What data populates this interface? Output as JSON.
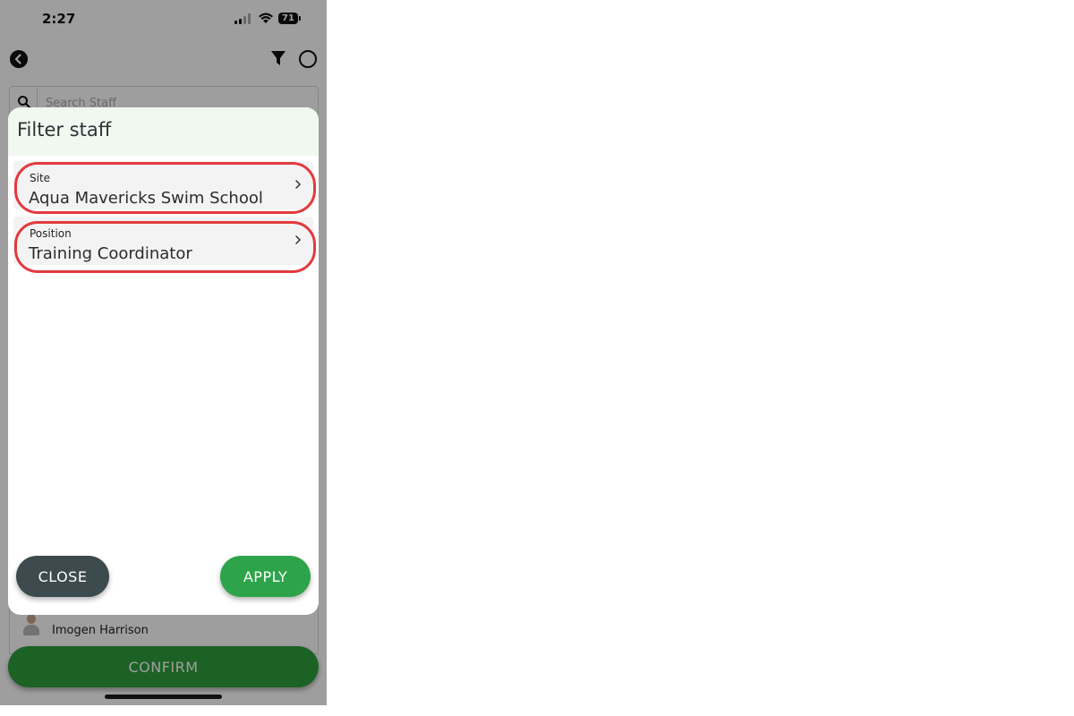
{
  "status_bar": {
    "time": "2:27",
    "battery": "71",
    "icons": [
      "signal-icon",
      "wifi-icon",
      "battery-icon"
    ]
  },
  "header": {
    "icons": [
      "back-icon",
      "filter-icon",
      "circle-icon"
    ]
  },
  "search": {
    "placeholder": "Search Staff",
    "value": "",
    "icon": "search-icon"
  },
  "staff_list": {
    "items": [
      {
        "name": "Imogen Harrison",
        "icon": "avatar"
      }
    ]
  },
  "confirm_label": "CONFIRM",
  "modal": {
    "title": "Filter staff",
    "fields": [
      {
        "label": "Site",
        "value": "Aqua Mavericks Swim School",
        "icon": "chevron-right-icon"
      },
      {
        "label": "Position",
        "value": "Training Coordinator",
        "icon": "chevron-right-icon"
      }
    ],
    "close_label": "CLOSE",
    "apply_label": "APPLY"
  },
  "colors": {
    "primary_green": "#2ea44a",
    "dark_button": "#3d4a4e",
    "modal_header_bg": "#f1f8f0",
    "highlight_ring": "#e23a3f"
  }
}
